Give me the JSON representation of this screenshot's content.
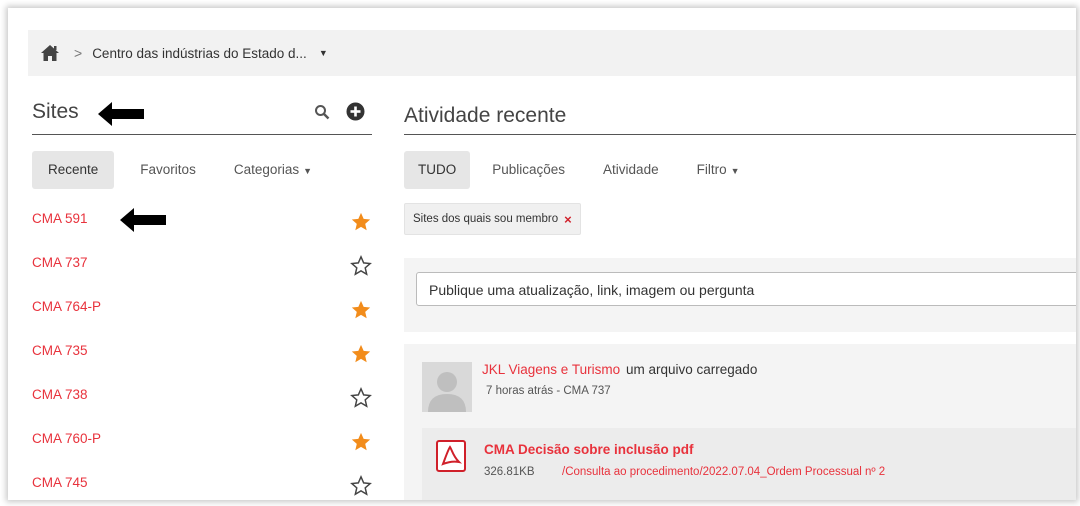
{
  "breadcrumb": {
    "home_icon": "home-icon",
    "separator": ">",
    "site": "Centro das indústrias do Estado d..."
  },
  "sites": {
    "title": "Sites",
    "tabs": [
      "Recente",
      "Favoritos",
      "Categorias"
    ],
    "items": [
      {
        "name": "CMA 591",
        "favorite": true
      },
      {
        "name": "CMA 737",
        "favorite": false
      },
      {
        "name": "CMA 764-P",
        "favorite": true
      },
      {
        "name": "CMA 735",
        "favorite": true
      },
      {
        "name": "CMA 738",
        "favorite": false
      },
      {
        "name": "CMA 760-P",
        "favorite": true
      },
      {
        "name": "CMA 745",
        "favorite": false
      }
    ]
  },
  "activity": {
    "title": "Atividade recente",
    "tabs": [
      "TUDO",
      "Publicações",
      "Atividade",
      "Filtro"
    ],
    "filter_chip": "Sites dos quais sou membro",
    "post_placeholder": "Publique uma atualização, link, imagem ou pergunta",
    "feed": {
      "actor": "JKL Viagens e Turismo",
      "action": "um arquivo carregado",
      "meta": "7 horas atrás - CMA 737",
      "file_title": "CMA Decisão sobre inclusão pdf",
      "file_size": "326.81KB",
      "file_path": "/Consulta ao procedimento/2022.07.04_Ordem Processual nº 2"
    }
  },
  "colors": {
    "accent_red": "#e8323c",
    "star_orange": "#f28c1b"
  }
}
